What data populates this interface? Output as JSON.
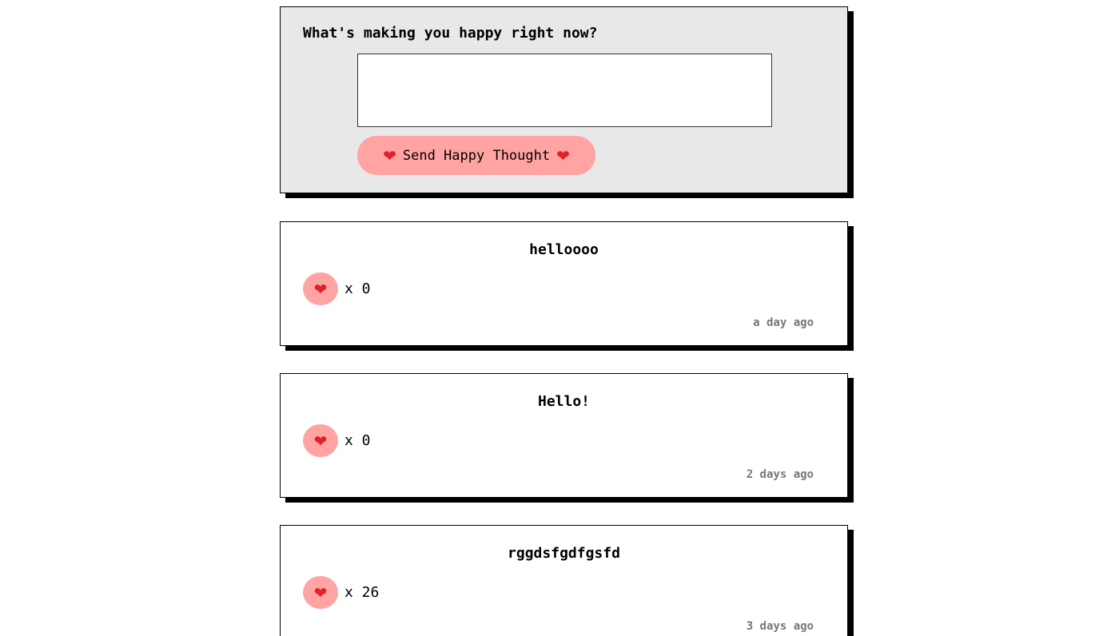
{
  "compose": {
    "title": "What's making you happy right now?",
    "input_value": "",
    "send_label": "Send Happy Thought"
  },
  "icons": {
    "heart": "heart-icon"
  },
  "colors": {
    "accent": "#ffa3a3",
    "compose_bg": "#e8e8e8",
    "heart": "#e0202a",
    "timestamp": "#777777"
  },
  "thoughts": [
    {
      "message": "helloooo",
      "likes": "x 0",
      "time": "a day ago"
    },
    {
      "message": "Hello!",
      "likes": "x 0",
      "time": "2 days ago"
    },
    {
      "message": "rggdsfgdfgsfd",
      "likes": "x 26",
      "time": "3 days ago"
    }
  ]
}
